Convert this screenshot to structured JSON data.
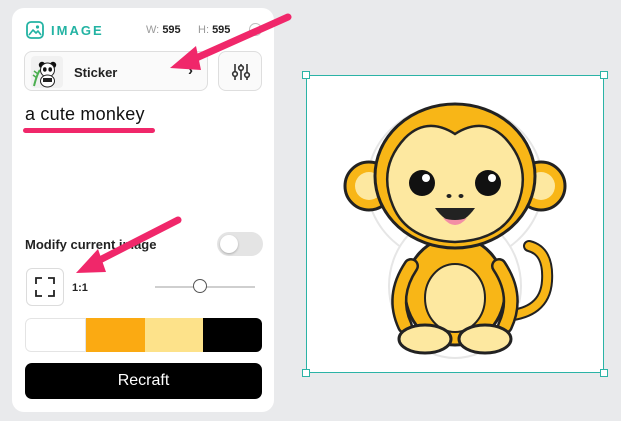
{
  "header": {
    "icon": "image-icon",
    "title": "IMAGE",
    "width_label": "W:",
    "width_value": "595",
    "height_label": "H:",
    "height_value": "595"
  },
  "style_selector": {
    "label": "Sticker",
    "thumbnail": "panda-sticker",
    "chevron": "›"
  },
  "settings_icon": "sliders-icon",
  "prompt": {
    "text": "a cute monkey"
  },
  "modify": {
    "label": "Modify current image",
    "enabled": false
  },
  "aspect_ratio": {
    "icon": "aspect-ratio-icon",
    "label": "1:1",
    "slider_value": 0.45
  },
  "palette": {
    "colors": [
      "#ffffff",
      "#fbaa12",
      "#fde28a",
      "#000000"
    ]
  },
  "generate_button": {
    "label": "Recraft"
  },
  "colors": {
    "accent": "#23b3a3",
    "annotation": "#f0276a",
    "monkey_fur": "#f8b617",
    "monkey_face": "#fde8a0"
  },
  "canvas": {
    "content": "monkey-sticker-image"
  }
}
